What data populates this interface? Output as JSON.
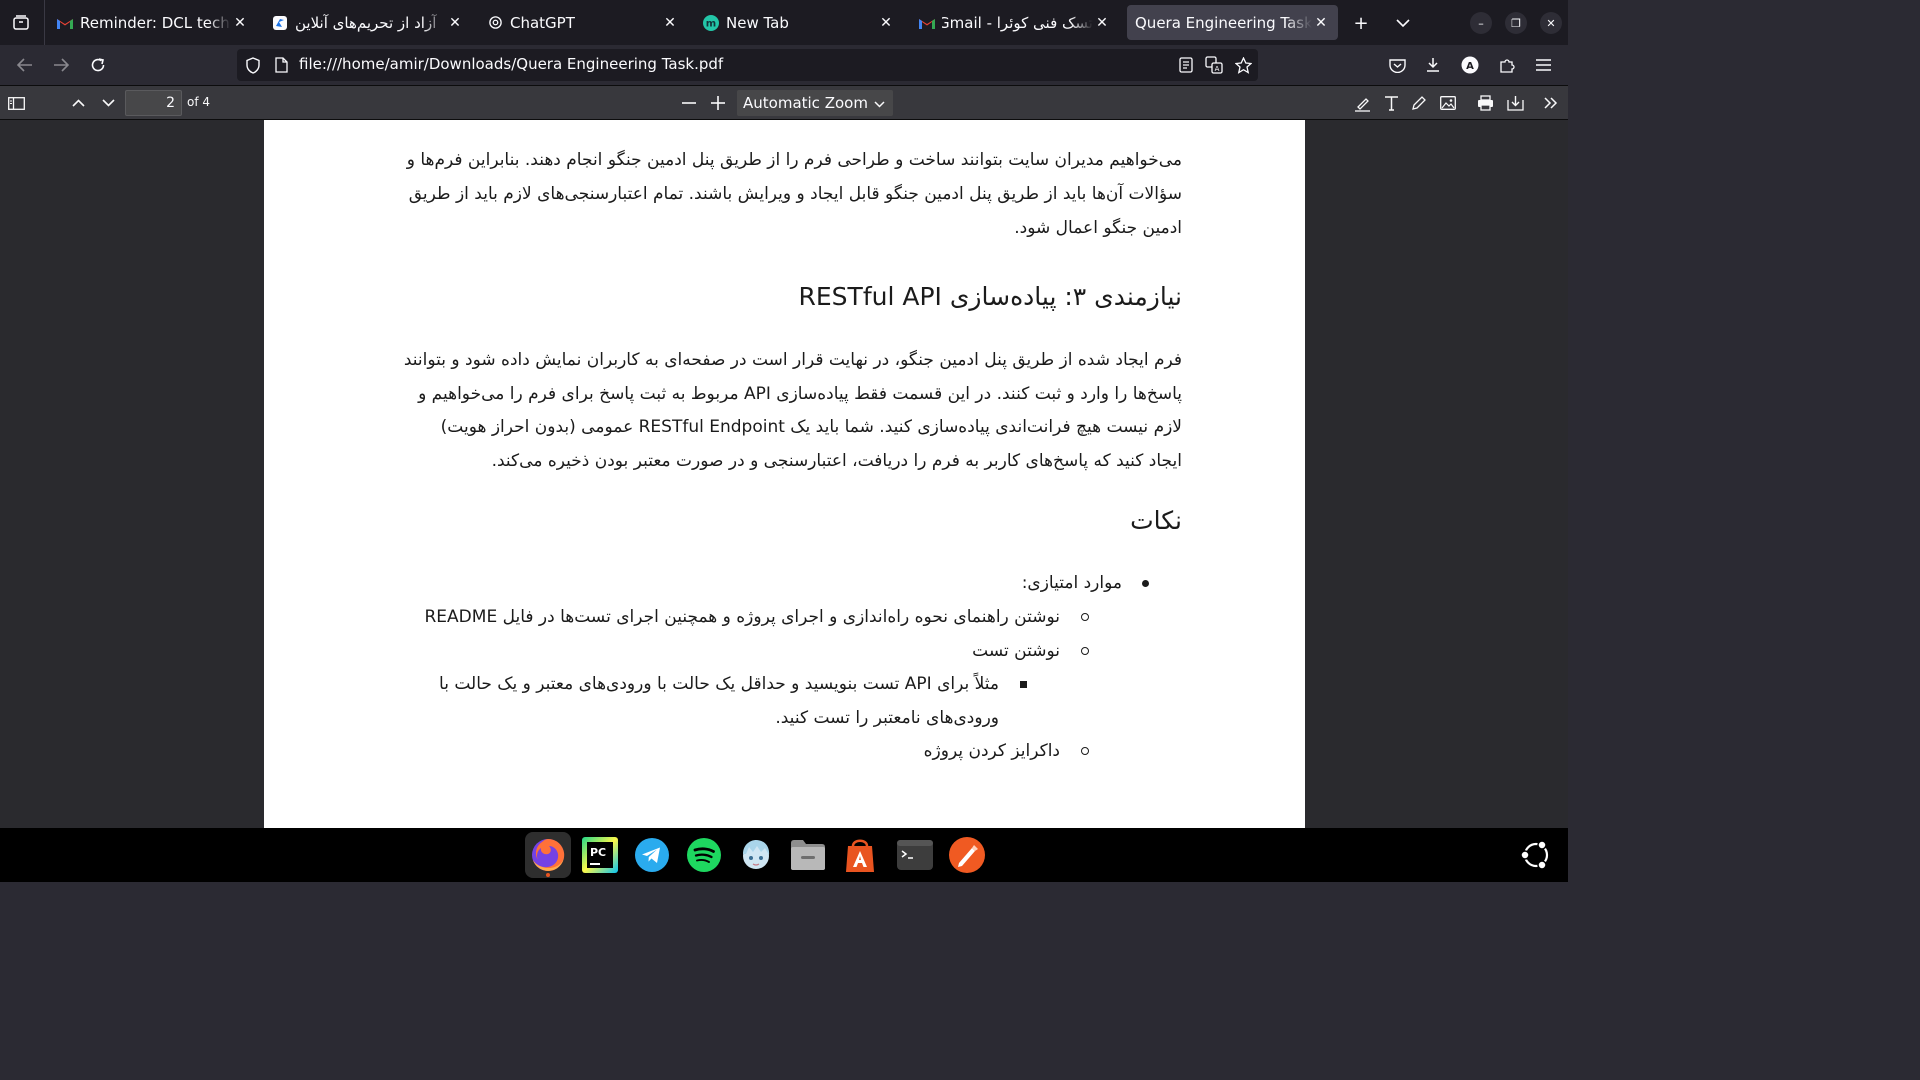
{
  "browser": {
    "tabs": [
      {
        "title": "Reminder: DCL technica",
        "favicon": "gmail-icon",
        "active": false
      },
      {
        "title": "آزاد از تحریم‌های آنلاین",
        "favicon": "shekan-icon",
        "active": false
      },
      {
        "title": "ChatGPT",
        "favicon": "openai-icon",
        "active": false
      },
      {
        "title": "New Tab",
        "favicon": "monica-icon",
        "active": false
      },
      {
        "title": "تسک فنی کوئرا - Gmail",
        "favicon": "gmail-icon",
        "active": false
      },
      {
        "title": "Quera Engineering Task.pdf",
        "favicon": "pdf-icon",
        "active": true
      }
    ],
    "url": "file:///home/amir/Downloads/Quera Engineering Task.pdf",
    "profile_initial": "A"
  },
  "pdf_toolbar": {
    "page_number": "2",
    "page_count": "of 4",
    "zoom": "Automatic Zoom"
  },
  "document": {
    "para1": [
      "می‌خواهیم مدیران سایت بتوانند ساخت و طراحی فرم را از طریق پنل ادمین جنگو انجام دهند. بنابراین فرم‌ها و",
      "سؤالات آن‌ها باید از طریق پنل ادمین جنگو قابل ایجاد و ویرایش باشند. تمام اعتبارسنجی‌های لازم باید از طریق",
      "ادمین جنگو اعمال شود."
    ],
    "heading_req3": "نیازمندی ۳: پیاده‌سازی RESTful API",
    "para2": [
      "فرم ایجاد شده از طریق پنل ادمین جنگو، در نهایت قرار است در صفحه‌ای به کاربران نمایش داده شود و بتوانند",
      "پاسخ‌ها را وارد و ثبت کنند. در این قسمت فقط پیاده‌سازی API مربوط به ثبت پاسخ برای فرم را می‌خواهیم و",
      "لازم نیست هیچ فرانت‌اندی پیاده‌سازی کنید. شما باید یک RESTful Endpoint عمومی (بدون احراز هویت)",
      "ایجاد کنید که پاسخ‌های کاربر به فرم را دریافت، اعتبارسنجی و در صورت معتبر بودن ذخیره می‌کند."
    ],
    "heading_notes": "نکات",
    "bonus_title": "موارد امتیازی:",
    "bonus_readme": "نوشتن راهنمای نحوه راه‌اندازی و اجرای پروژه و همچنین اجرای تست‌ها در فایل README",
    "bonus_tests": "نوشتن تست",
    "bonus_tests_detail_1": "مثلاً برای API تست بنویسید و حداقل یک حالت با ورودی‌های معتبر و یک حالت با",
    "bonus_tests_detail_2": "ورودی‌های نامعتبر را تست کنید.",
    "bonus_docker": "داکرایز کردن پروژه"
  },
  "dock": {
    "apps": [
      "firefox-icon",
      "pycharm-icon",
      "telegram-icon",
      "spotify-icon",
      "anime-app-icon",
      "files-icon",
      "app-center-icon",
      "terminal-icon",
      "inkscape-icon"
    ],
    "pycharm_label": "PC"
  },
  "colors": {
    "tab_strip": "#1c1b22",
    "active_tab": "#42414d",
    "toolbar": "#2b2a33",
    "pdf_toolbar": "#38383d",
    "viewer_bg": "#2a2a2e",
    "ubuntu_orange": "#e95420"
  }
}
